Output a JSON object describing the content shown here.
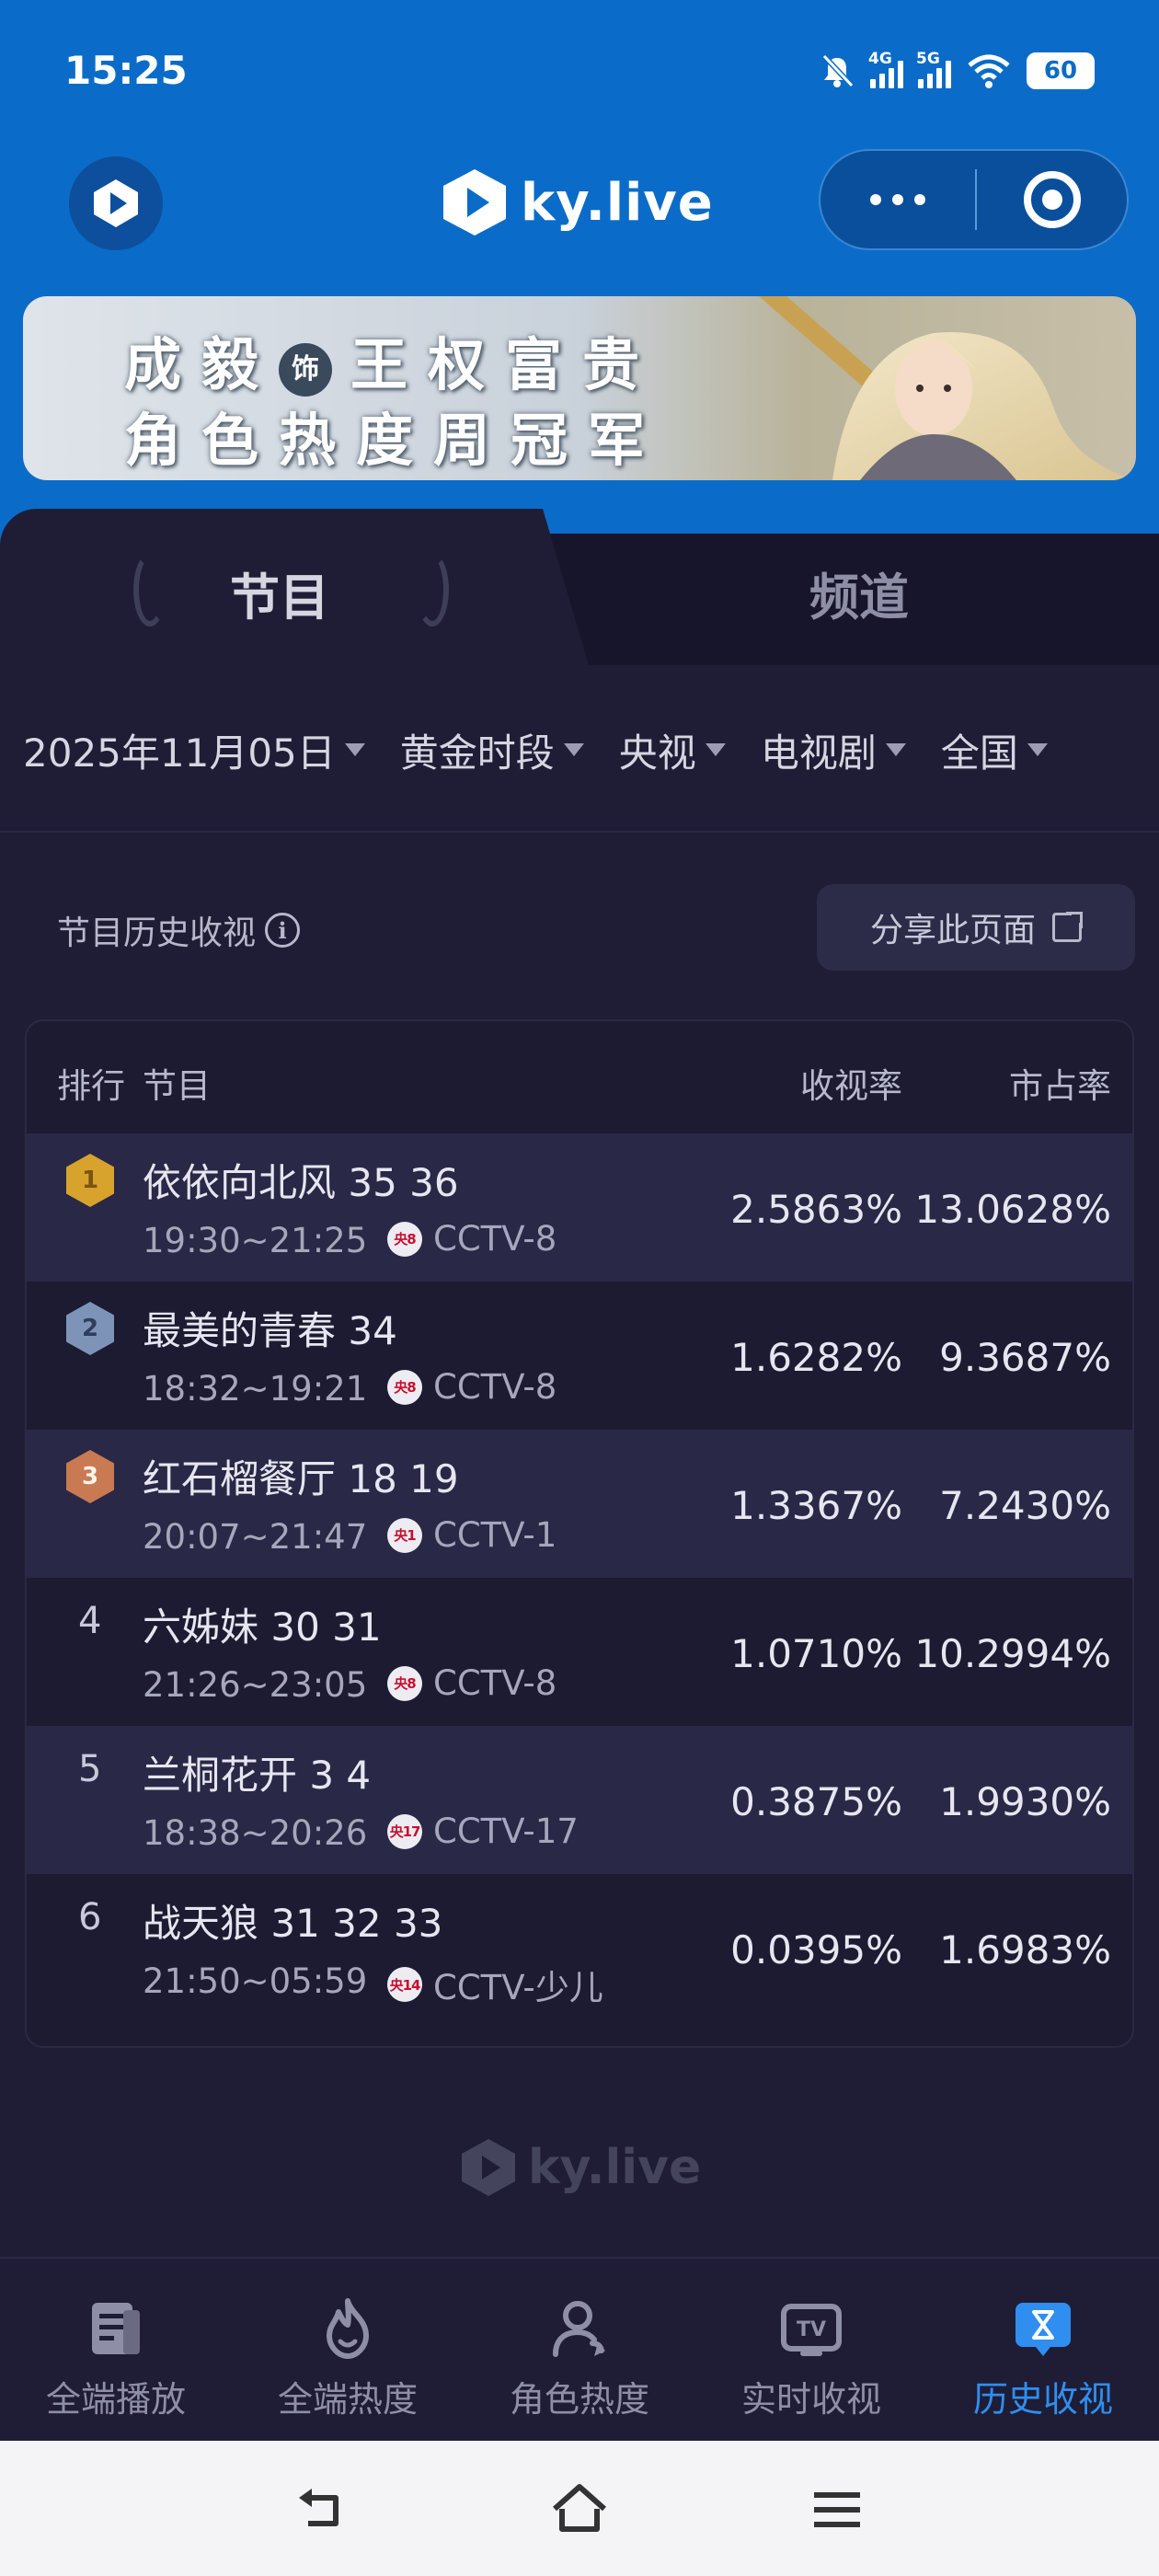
{
  "status_bar": {
    "time": "15:25",
    "network1": "4G",
    "network2": "5G",
    "battery": "60"
  },
  "header": {
    "logo_text": "ky.live"
  },
  "banner": {
    "line1_prefix": "成毅",
    "badge": "饰",
    "line1_suffix": "王权富贵",
    "line2": "角色热度周冠军"
  },
  "tabs": [
    {
      "label": "节目",
      "active": true
    },
    {
      "label": "频道",
      "active": false
    }
  ],
  "filters": [
    "2025年11月05日",
    "黄金时段",
    "央视",
    "电视剧",
    "全国"
  ],
  "history": {
    "title": "节目历史收视",
    "share_label": "分享此页面"
  },
  "table": {
    "headers": {
      "rank": "排行",
      "program": "节目",
      "rating": "收视率",
      "share": "市占率"
    },
    "rows": [
      {
        "rank": "1",
        "name": "依依向北风 35 36",
        "time": "19:30~21:25",
        "channel_logo": "央8",
        "channel": "CCTV-8",
        "rating": "2.5863%",
        "share": "13.0628%"
      },
      {
        "rank": "2",
        "name": "最美的青春 34",
        "time": "18:32~19:21",
        "channel_logo": "央8",
        "channel": "CCTV-8",
        "rating": "1.6282%",
        "share": "9.3687%"
      },
      {
        "rank": "3",
        "name": "红石榴餐厅 18 19",
        "time": "20:07~21:47",
        "channel_logo": "央1",
        "channel": "CCTV-1",
        "rating": "1.3367%",
        "share": "7.2430%"
      },
      {
        "rank": "4",
        "name": "六姊妹 30 31",
        "time": "21:26~23:05",
        "channel_logo": "央8",
        "channel": "CCTV-8",
        "rating": "1.0710%",
        "share": "10.2994%"
      },
      {
        "rank": "5",
        "name": "兰桐花开 3 4",
        "time": "18:38~20:26",
        "channel_logo": "央17",
        "channel": "CCTV-17",
        "rating": "0.3875%",
        "share": "1.9930%"
      },
      {
        "rank": "6",
        "name": "战天狼 31 32 33",
        "time": "21:50~05:59",
        "channel_logo": "央14",
        "channel": "CCTV-少儿",
        "rating": "0.0395%",
        "share": "1.6983%"
      }
    ]
  },
  "footer": {
    "logo_text": "ky.live"
  },
  "bottom_nav": [
    {
      "label": "全端播放",
      "icon": "play-doc-icon"
    },
    {
      "label": "全端热度",
      "icon": "flame-icon"
    },
    {
      "label": "角色热度",
      "icon": "person-icon"
    },
    {
      "label": "实时收视",
      "icon": "tv-icon"
    },
    {
      "label": "历史收视",
      "icon": "history-icon",
      "active": true
    }
  ],
  "colors": {
    "primary_blue": "#0a6cc8",
    "background": "#1e1d35",
    "active_nav": "#2f8ef0",
    "gold": "#d7a32d",
    "silver": "#7e93b8",
    "bronze": "#c97a52"
  }
}
